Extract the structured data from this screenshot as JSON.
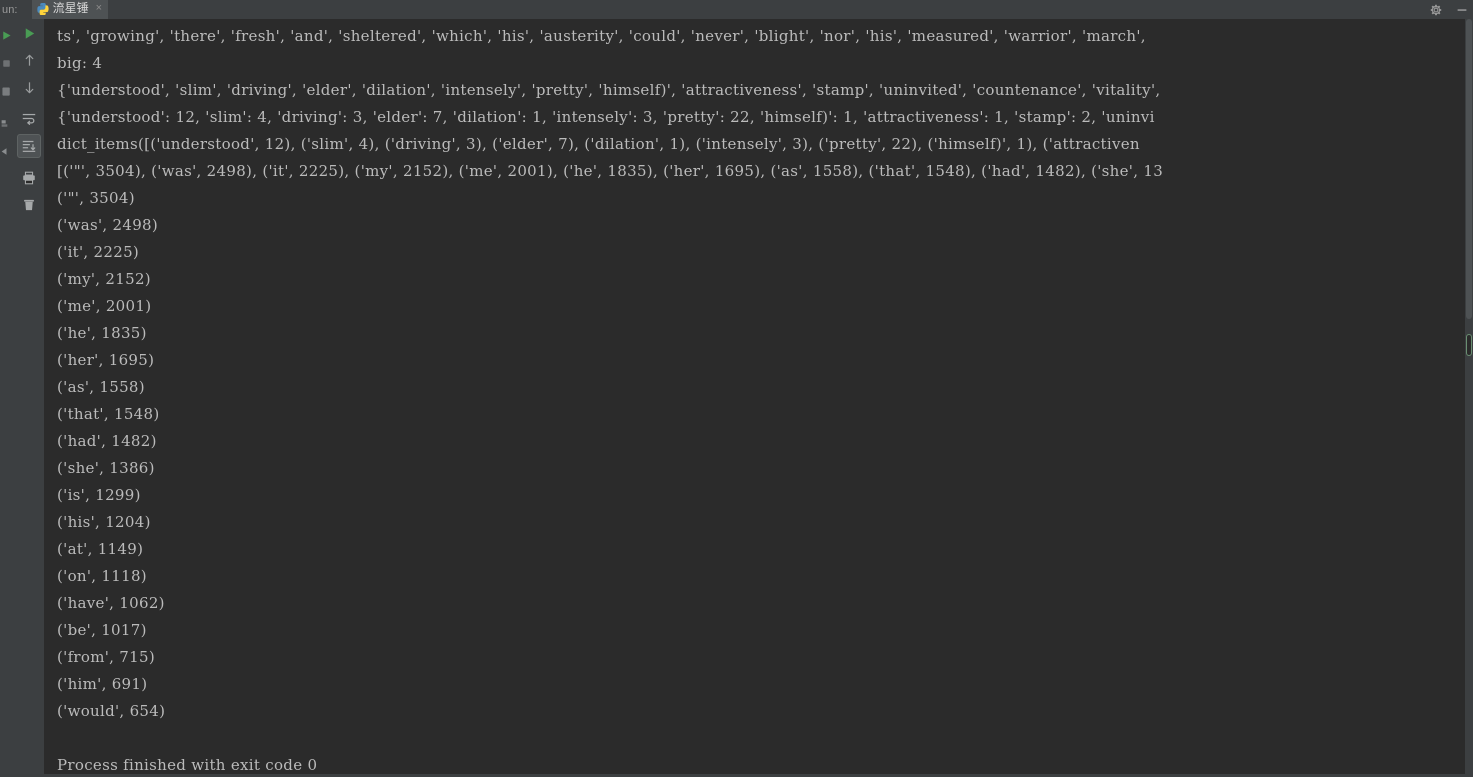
{
  "window": {
    "run_label": "un:",
    "settings_icon": "gear-icon",
    "minimize_icon": "minimize-icon"
  },
  "tab": {
    "icon": "python-file-icon",
    "title": "流星锤",
    "close": "×"
  },
  "left_strip": {
    "icons": [
      "run-green-arrow-icon",
      "stop-square-icon",
      "layout-icon",
      "debug-icon",
      "pin-icon"
    ]
  },
  "run_toolbar": {
    "buttons": [
      {
        "name": "rerun-button",
        "icon": "play-green-icon",
        "label": "Rerun"
      },
      {
        "name": "scroll-up-button",
        "icon": "arrow-up-icon",
        "label": "Up the Stack Trace"
      },
      {
        "name": "scroll-down-button",
        "icon": "arrow-down-icon",
        "label": "Down the Stack Trace"
      },
      {
        "name": "soft-wrap-button",
        "icon": "soft-wrap-icon",
        "label": "Soft-Wrap"
      },
      {
        "name": "scroll-to-end-button",
        "icon": "scroll-to-end-icon",
        "label": "Scroll to End",
        "selected": true
      },
      {
        "name": "print-button",
        "icon": "printer-icon",
        "label": "Print"
      },
      {
        "name": "clear-all-button",
        "icon": "trash-icon",
        "label": "Clear All"
      }
    ]
  },
  "console": {
    "lines": [
      "ts', 'growing', 'there', 'fresh', 'and', 'sheltered', 'which', 'his', 'austerity', 'could', 'never', 'blight', 'nor', 'his', 'measured', 'warrior', 'march',",
      "big: 4",
      "{'understood', 'slim', 'driving', 'elder', 'dilation', 'intensely', 'pretty', 'himself)', 'attractiveness', 'stamp', 'uninvited', 'countenance', 'vitality',",
      "{'understood': 12, 'slim': 4, 'driving': 3, 'elder': 7, 'dilation': 1, 'intensely': 3, 'pretty': 22, 'himself)': 1, 'attractiveness': 1, 'stamp': 2, 'uninvi",
      "dict_items([('understood', 12), ('slim', 4), ('driving', 3), ('elder', 7), ('dilation', 1), ('intensely', 3), ('pretty', 22), ('himself)', 1), ('attractiven",
      "[('\"', 3504), ('was', 2498), ('it', 2225), ('my', 2152), ('me', 2001), ('he', 1835), ('her', 1695), ('as', 1558), ('that', 1548), ('had', 1482), ('she', 13",
      "('\"', 3504)",
      "('was', 2498)",
      "('it', 2225)",
      "('my', 2152)",
      "('me', 2001)",
      "('he', 1835)",
      "('her', 1695)",
      "('as', 1558)",
      "('that', 1548)",
      "('had', 1482)",
      "('she', 1386)",
      "('is', 1299)",
      "('his', 1204)",
      "('at', 1149)",
      "('on', 1118)",
      "('have', 1062)",
      "('be', 1017)",
      "('from', 715)",
      "('him', 691)",
      "('would', 654)",
      "",
      "Process finished with exit code 0"
    ],
    "word_counts": [
      {
        "word": "\"",
        "count": 3504
      },
      {
        "word": "was",
        "count": 2498
      },
      {
        "word": "it",
        "count": 2225
      },
      {
        "word": "my",
        "count": 2152
      },
      {
        "word": "me",
        "count": 2001
      },
      {
        "word": "he",
        "count": 1835
      },
      {
        "word": "her",
        "count": 1695
      },
      {
        "word": "as",
        "count": 1558
      },
      {
        "word": "that",
        "count": 1548
      },
      {
        "word": "had",
        "count": 1482
      },
      {
        "word": "she",
        "count": 1386
      },
      {
        "word": "is",
        "count": 1299
      },
      {
        "word": "his",
        "count": 1204
      },
      {
        "word": "at",
        "count": 1149
      },
      {
        "word": "on",
        "count": 1118
      },
      {
        "word": "have",
        "count": 1062
      },
      {
        "word": "be",
        "count": 1017
      },
      {
        "word": "from",
        "count": 715
      },
      {
        "word": "him",
        "count": 691
      },
      {
        "word": "would",
        "count": 654
      }
    ],
    "exit_status": "Process finished with exit code 0",
    "big_value": 4
  },
  "colors": {
    "console_bg": "#2b2b2b",
    "chrome_bg": "#3c3f41",
    "text": "#bbbbbb",
    "tab_active_bg": "#4e5254",
    "accent_green": "#499c54"
  }
}
